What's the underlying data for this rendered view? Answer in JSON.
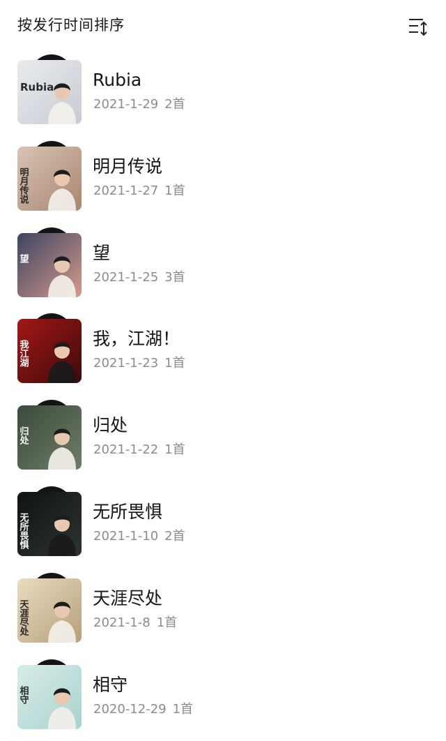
{
  "header": {
    "title": "按发行时间排序",
    "sort_icon": "sort-order-icon"
  },
  "albums": [
    {
      "title": "Rubia",
      "date": "2021-1-29",
      "count": "2首",
      "cover_text": "Rubia",
      "cover_colors": [
        "#e9ebee",
        "#c7ccd3"
      ]
    },
    {
      "title": "明月传说",
      "date": "2021-1-27",
      "count": "1首",
      "cover_text": "明月传说",
      "cover_colors": [
        "#d9c4b4",
        "#a88571"
      ]
    },
    {
      "title": "望",
      "date": "2021-1-25",
      "count": "3首",
      "cover_text": "望",
      "cover_colors": [
        "#3c4360",
        "#d59a8d"
      ]
    },
    {
      "title": "我，江湖！",
      "date": "2021-1-23",
      "count": "1首",
      "cover_text": "我江湖",
      "cover_colors": [
        "#a51616",
        "#3b0b0b"
      ]
    },
    {
      "title": "归处",
      "date": "2021-1-22",
      "count": "1首",
      "cover_text": "归处",
      "cover_colors": [
        "#3c4a3c",
        "#6d7e67"
      ]
    },
    {
      "title": "无所畏惧",
      "date": "2021-1-10",
      "count": "2首",
      "cover_text": "无所畏惧",
      "cover_colors": [
        "#0f1311",
        "#2c3530"
      ]
    },
    {
      "title": "天涯尽处",
      "date": "2021-1-8",
      "count": "1首",
      "cover_text": "天涯尽处",
      "cover_colors": [
        "#e9dcc0",
        "#b79f7a"
      ]
    },
    {
      "title": "相守",
      "date": "2020-12-29",
      "count": "1首",
      "cover_text": "相守",
      "cover_colors": [
        "#d8ece9",
        "#a9d2ce"
      ]
    }
  ]
}
